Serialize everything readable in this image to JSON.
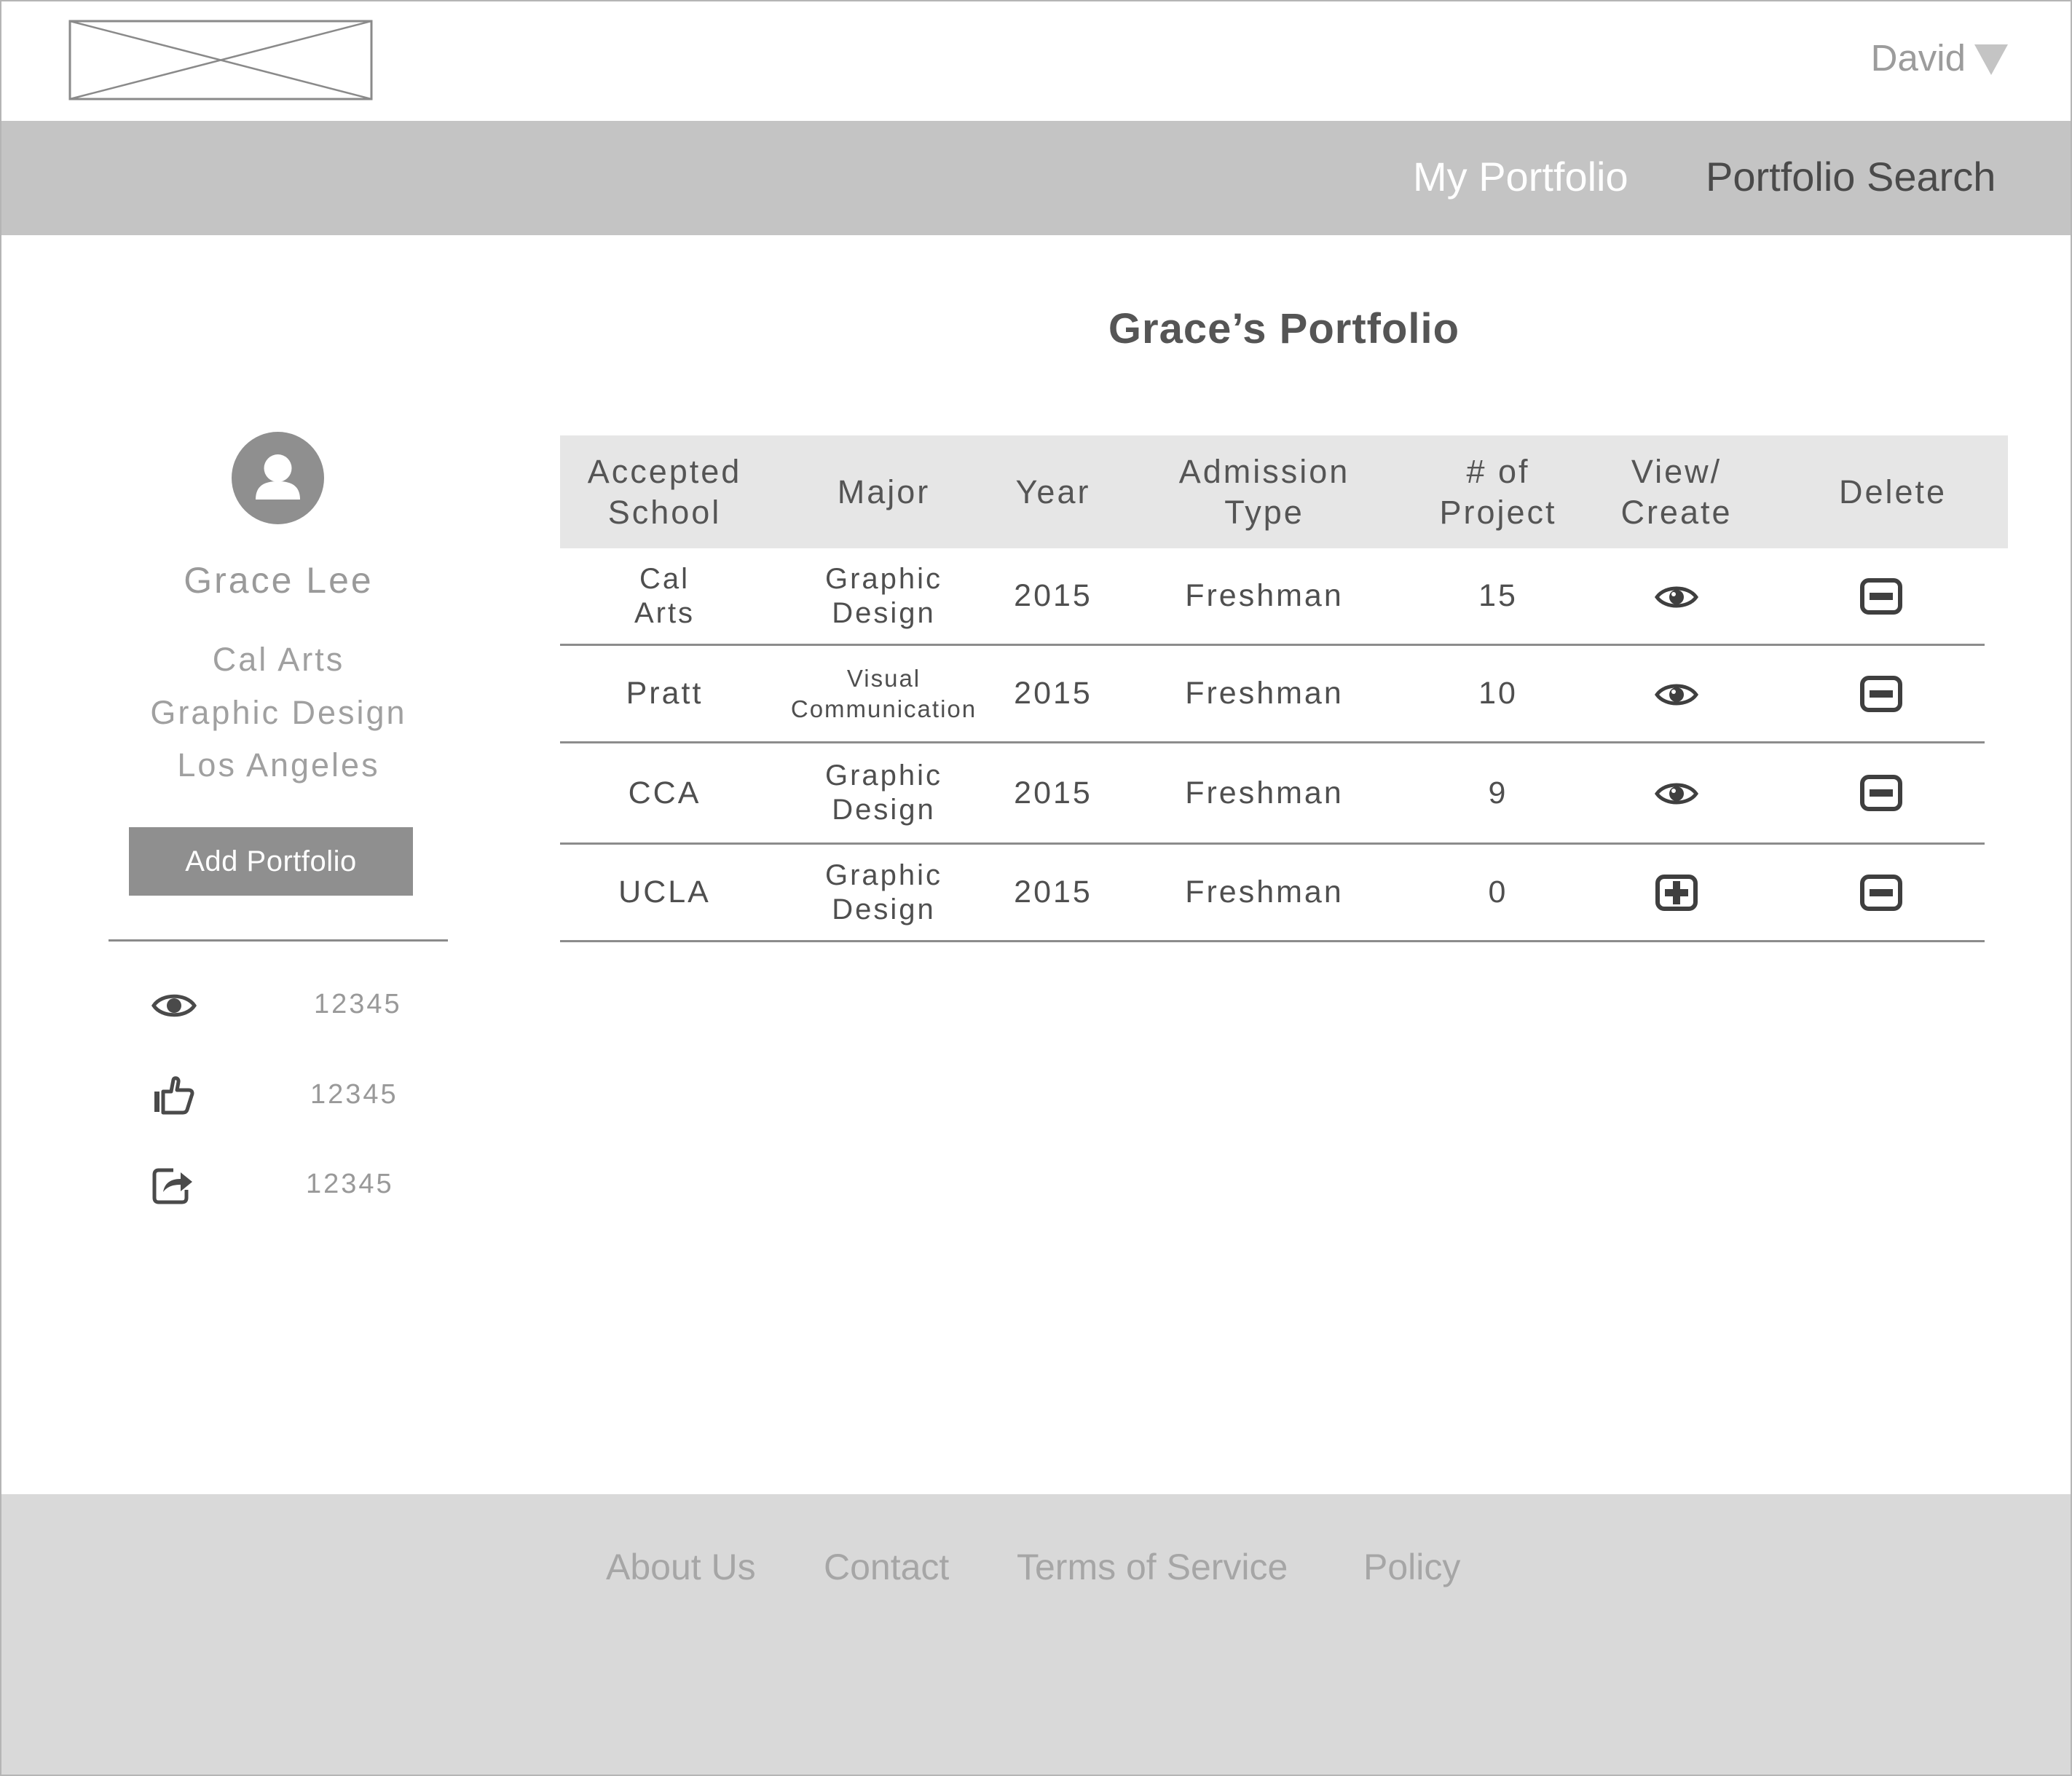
{
  "header": {
    "logo": "logo-placeholder-icon",
    "user_name": "David",
    "user_menu_icon": "caret-down-icon"
  },
  "nav": {
    "my_portfolio": "My Portfolio",
    "portfolio_search": "Portfolio Search"
  },
  "page": {
    "title": "Grace’s Portfolio"
  },
  "profile": {
    "avatar_icon": "user-avatar-icon",
    "name": "Grace Lee",
    "school": "Cal Arts",
    "major": "Graphic Design",
    "location": "Los Angeles",
    "add_button": "Add Portfolio",
    "stats": [
      {
        "icon": "eye-icon",
        "value": "12345"
      },
      {
        "icon": "thumbs-up-icon",
        "value": "12345"
      },
      {
        "icon": "share-icon",
        "value": "12345"
      }
    ]
  },
  "table": {
    "headers": {
      "school_1": "Accepted",
      "school_2": "School",
      "major": "Major",
      "year": "Year",
      "admission_1": "Admission",
      "admission_2": "Type",
      "projects_1": "# of",
      "projects_2": "Project",
      "view_1": "View/",
      "view_2": "Create",
      "delete": "Delete"
    },
    "rows": [
      {
        "school_1": "Cal",
        "school_2": "Arts",
        "major_1": "Graphic",
        "major_2": "Design",
        "year": "2015",
        "admission": "Freshman",
        "projects": "15",
        "action_icon": "eye-icon",
        "delete_icon": "minus-box-icon"
      },
      {
        "school_1": "Pratt",
        "school_2": "",
        "major_1": "Visual",
        "major_2": "Communication",
        "year": "2015",
        "admission": "Freshman",
        "projects": "10",
        "action_icon": "eye-icon",
        "delete_icon": "minus-box-icon"
      },
      {
        "school_1": "CCA",
        "school_2": "",
        "major_1": "Graphic",
        "major_2": "Design",
        "year": "2015",
        "admission": "Freshman",
        "projects": "9",
        "action_icon": "eye-icon",
        "delete_icon": "minus-box-icon"
      },
      {
        "school_1": "UCLA",
        "school_2": "",
        "major_1": "Graphic",
        "major_2": "Design",
        "year": "2015",
        "admission": "Freshman",
        "projects": "0",
        "action_icon": "plus-box-icon",
        "delete_icon": "minus-box-icon"
      }
    ]
  },
  "footer": {
    "about": "About Us",
    "contact": "Contact",
    "terms": "Terms of Service",
    "policy": "Policy"
  }
}
